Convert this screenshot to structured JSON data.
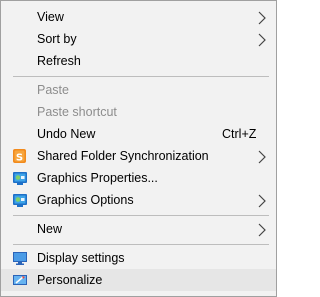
{
  "menu": {
    "view": "View",
    "sort_by": "Sort by",
    "refresh": "Refresh",
    "paste": "Paste",
    "paste_shortcut": "Paste shortcut",
    "undo_new": "Undo New",
    "undo_shortcut": "Ctrl+Z",
    "shared_folder_sync": "Shared Folder Synchronization",
    "graphics_properties": "Graphics Properties...",
    "graphics_options": "Graphics Options",
    "new": "New",
    "display_settings": "Display settings",
    "personalize": "Personalize"
  },
  "icons": {
    "shared_folder_sync": "shared-folder-sync-icon",
    "graphics": "intel-graphics-icon",
    "display": "display-settings-icon",
    "personalize": "personalize-icon"
  },
  "colors": {
    "menu_bg": "#f2f2f2",
    "highlight_bg": "#e6e6e6",
    "disabled_text": "#8d8d8d",
    "separator": "#bdbdbd"
  }
}
